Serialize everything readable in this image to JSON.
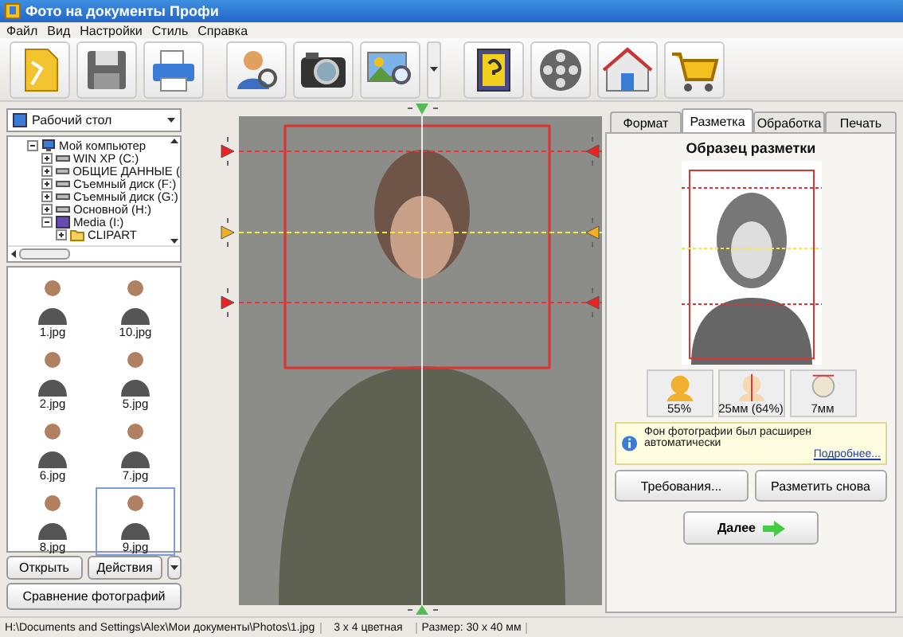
{
  "window": {
    "title": "Фото на документы Профи"
  },
  "menu": [
    "Файл",
    "Вид",
    "Настройки",
    "Стиль",
    "Справка"
  ],
  "left_panel": {
    "folder": "Рабочий стол",
    "tree": [
      {
        "label": "Мой компьютер",
        "kind": "computer",
        "expanded": true,
        "children": [
          {
            "label": "WIN XP (C:)",
            "kind": "drive",
            "expanded": false
          },
          {
            "label": "ОБЩИЕ ДАННЫЕ (",
            "kind": "drive",
            "expanded": false
          },
          {
            "label": "Съемный диск (F:)",
            "kind": "drive",
            "expanded": false
          },
          {
            "label": "Съемный диск (G:)",
            "kind": "drive",
            "expanded": false
          },
          {
            "label": "Основной (H:)",
            "kind": "drive",
            "expanded": false
          },
          {
            "label": "Media (I:)",
            "kind": "media",
            "expanded": true,
            "children": [
              {
                "label": "CLIPART",
                "kind": "folder",
                "expanded": false
              }
            ]
          }
        ]
      }
    ],
    "thumbnails": [
      {
        "label": "1.jpg",
        "selected": false
      },
      {
        "label": "10.jpg",
        "selected": false
      },
      {
        "label": "2.jpg",
        "selected": false
      },
      {
        "label": "5.jpg",
        "selected": false
      },
      {
        "label": "6.jpg",
        "selected": false
      },
      {
        "label": "7.jpg",
        "selected": false
      },
      {
        "label": "8.jpg",
        "selected": false
      },
      {
        "label": "9.jpg",
        "selected": true
      }
    ],
    "buttons": [
      "Открыть",
      "Действия"
    ],
    "compare_button": "Сравнение фотографий"
  },
  "tabs": [
    {
      "label": "Формат",
      "selected": false
    },
    {
      "label": "Разметка",
      "selected": true
    },
    {
      "label": "Обработка",
      "selected": false
    },
    {
      "label": "Печать",
      "selected": false
    }
  ],
  "sample": {
    "title": "Образец разметки"
  },
  "stats": [
    {
      "kind": "head",
      "label": "55%"
    },
    {
      "kind": "face-height",
      "label": "25мм (64%)"
    },
    {
      "kind": "crown",
      "label": "7мм"
    }
  ],
  "info": {
    "text": "Фон фотографии был расширен автоматически",
    "link": "Подробнее..."
  },
  "actions": [
    "Требования...",
    "Разметить снова"
  ],
  "next_button": "Далее",
  "status_bar": {
    "path": "H:\\Documents and Settings\\Alex\\Мои документы\\Photos\\1.jpg",
    "format": "3 x 4 цветная",
    "size": "Размер: 30 x 40 мм"
  }
}
